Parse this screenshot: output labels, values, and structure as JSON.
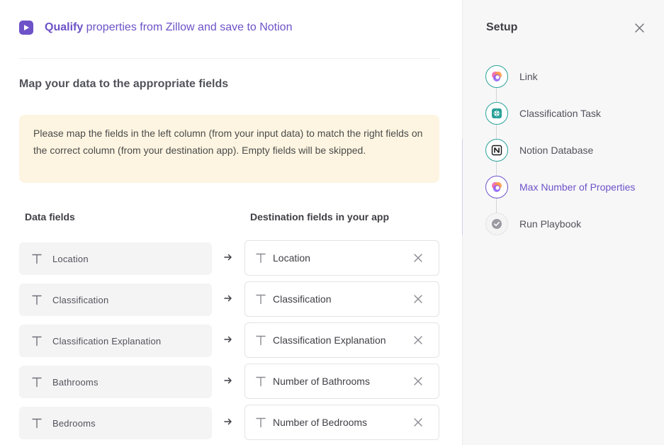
{
  "header": {
    "title_strong": "Qualify",
    "title_rest": " properties from Zillow and save to Notion",
    "icon": "play-icon"
  },
  "main": {
    "section_title": "Map your data to the appropriate fields",
    "notice": "Please map the fields in the left column (from your input data) to match the right fields on the correct column (from your destination app). Empty fields will be skipped.",
    "col_left": "Data fields",
    "col_right": "Destination fields in your app"
  },
  "mappings": [
    {
      "source": "Location",
      "destination": "Location"
    },
    {
      "source": "Classification",
      "destination": "Classification"
    },
    {
      "source": "Classification Explanation",
      "destination": "Classification Explanation"
    },
    {
      "source": "Bathrooms",
      "destination": "Number of Bathrooms"
    },
    {
      "source": "Bedrooms",
      "destination": "Number of Bedrooms"
    }
  ],
  "sidebar": {
    "title": "Setup",
    "steps": [
      {
        "label": "Link",
        "icon": "app-logo-icon",
        "state": "done"
      },
      {
        "label": "Classification Task",
        "icon": "ai-chip-icon",
        "state": "done"
      },
      {
        "label": "Notion Database",
        "icon": "notion-icon",
        "state": "done"
      },
      {
        "label": "Max Number of Properties",
        "icon": "app-logo-icon",
        "state": "active"
      },
      {
        "label": "Run Playbook",
        "icon": "check-circle-icon",
        "state": "pending"
      }
    ]
  },
  "colors": {
    "accent": "#6d52c8",
    "teal": "#2aa198",
    "notice_bg": "#fdf5e1"
  }
}
